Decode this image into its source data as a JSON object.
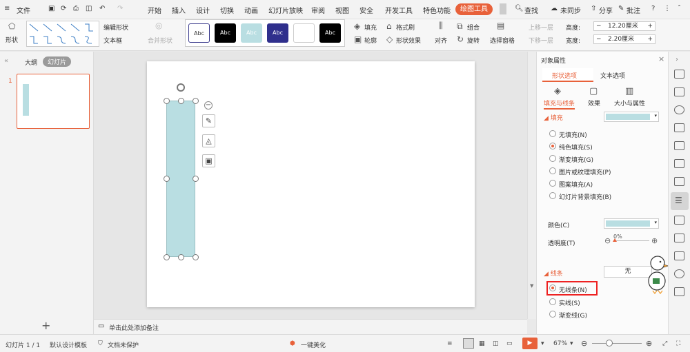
{
  "menubar": {
    "file": "文件",
    "tabs": [
      "开始",
      "插入",
      "设计",
      "切换",
      "动画",
      "幻灯片放映",
      "审阅",
      "视图",
      "安全",
      "开发工具",
      "特色功能"
    ],
    "active_tab": "绘图工具",
    "search": "查找",
    "sync": "未同步",
    "share": "分享",
    "comment": "批注"
  },
  "ribbon": {
    "shape": "形状",
    "edit_shape": "编辑形状",
    "text_box": "文本框",
    "merge_shape": "合并形状",
    "style_samples": [
      "Abc",
      "Abc",
      "Abc",
      "Abc",
      "",
      "Abc"
    ],
    "fill": "填充",
    "format_painter": "格式刷",
    "outline": "轮廓",
    "shape_effect": "形状效果",
    "align": "对齐",
    "group": "组合",
    "rotate": "旋转",
    "selection_pane": "选择窗格",
    "bring_forward": "上移一层",
    "send_backward": "下移一层",
    "height_label": "高度:",
    "height_value": "12.20厘米",
    "width_label": "宽度:",
    "width_value": "2.20厘米"
  },
  "leftpanel": {
    "outline_tab": "大纲",
    "slides_tab": "幻灯片",
    "slide_number": "1"
  },
  "notes": {
    "placeholder": "单击此处添加备注"
  },
  "rightpanel": {
    "title": "对象属性",
    "tab_shape": "形状选项",
    "tab_text": "文本选项",
    "sub_fill_line": "填充与线条",
    "sub_effect": "效果",
    "sub_size": "大小与属性",
    "fill_section": "填充",
    "fill_options": [
      "无填充(N)",
      "纯色填充(S)",
      "渐变填充(G)",
      "图片或纹理填充(P)",
      "图案填充(A)",
      "幻灯片背景填充(B)"
    ],
    "fill_selected_index": 1,
    "color_label": "颜色(C)",
    "transparency_label": "透明度(T)",
    "transparency_value": "0%",
    "line_section": "线条",
    "line_value": "无",
    "line_options": [
      "无线条(N)",
      "实线(S)",
      "渐变线(G)"
    ],
    "line_selected_index": 0,
    "fill_color": "#b9dee2"
  },
  "statusbar": {
    "slide_info": "幻灯片 1 / 1",
    "template": "默认设计模板",
    "protection": "文档未保护",
    "beautify": "一键美化",
    "zoom": "67%"
  },
  "shape": {
    "fill": "#b9dee2"
  }
}
